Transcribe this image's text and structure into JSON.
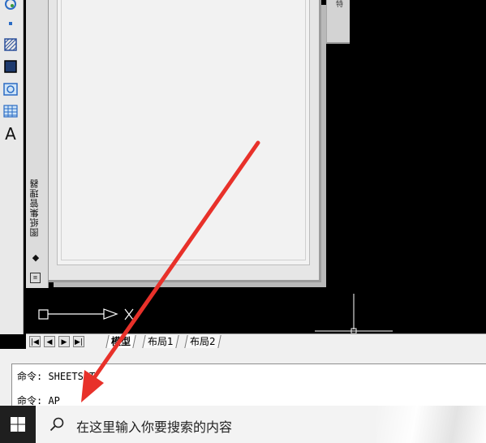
{
  "left_toolbar": {
    "icons": [
      "swirl-tool-icon",
      "point-icon",
      "hatch-icon",
      "gradient-icon",
      "region-icon",
      "table-icon",
      "mtext-icon"
    ],
    "text_tool_label": "A"
  },
  "palette": {
    "title": "图纸集管理器",
    "right_tab_label": "特"
  },
  "layout_tabs": {
    "nav": [
      "|◀",
      "◀",
      "▶",
      "▶|"
    ],
    "tabs": [
      {
        "label": "模型",
        "active": true
      },
      {
        "label": "布局1",
        "active": false
      },
      {
        "label": "布局2",
        "active": false
      }
    ]
  },
  "command_line": {
    "history": "命令: SHEETSET",
    "current": "命令: AP"
  },
  "taskbar": {
    "search_placeholder": "在这里输入你要搜索的内容"
  },
  "colors": {
    "annotation_arrow": "#e8312a",
    "canvas_background": "#000000"
  }
}
